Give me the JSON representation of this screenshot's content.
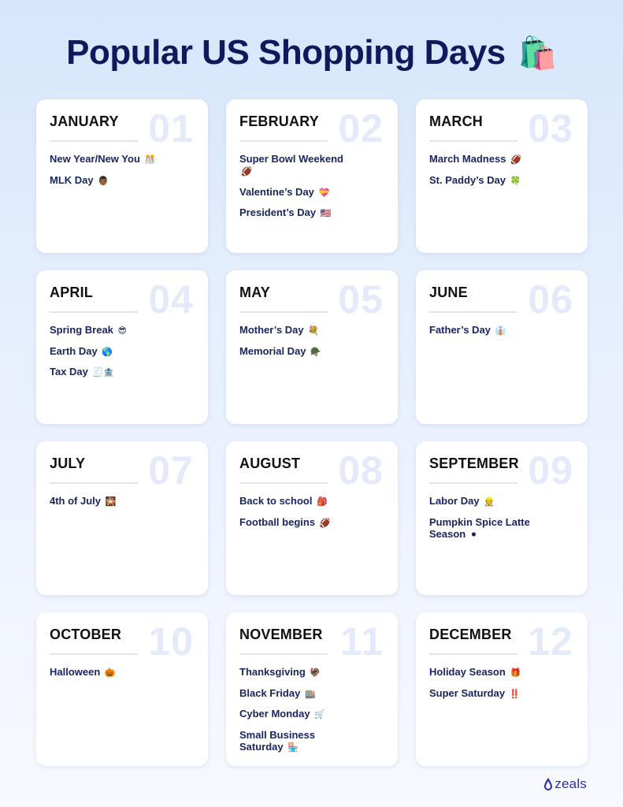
{
  "title": {
    "text": "Popular US Shopping Days",
    "emoji": "🛍️"
  },
  "months": [
    {
      "name": "JANUARY",
      "number": "01",
      "events": [
        {
          "label": "New Year/New You",
          "emoji": "🎊",
          "icon": "party-icon"
        },
        {
          "label": "MLK Day",
          "emoji": "👨🏾",
          "icon": "person-icon"
        }
      ]
    },
    {
      "name": "FEBRUARY",
      "number": "02",
      "events": [
        {
          "label": "Super Bowl Weekend",
          "emoji": "🏈",
          "icon": "football-icon"
        },
        {
          "label": "Valentine’s Day",
          "emoji": "💝",
          "icon": "heart-icon"
        },
        {
          "label": "President’s Day",
          "emoji": "🇺🇸",
          "icon": "us-flag-icon"
        }
      ]
    },
    {
      "name": "MARCH",
      "number": "03",
      "events": [
        {
          "label": "March Madness",
          "emoji": "🏈",
          "icon": "ball-icon"
        },
        {
          "label": "St. Paddy’s Day",
          "emoji": "🍀",
          "icon": "clover-icon"
        }
      ]
    },
    {
      "name": "APRIL",
      "number": "04",
      "events": [
        {
          "label": "Spring Break",
          "emoji": "😎",
          "icon": "sunglasses-face-icon"
        },
        {
          "label": "Earth Day",
          "emoji": "🌎",
          "icon": "globe-icon"
        },
        {
          "label": "Tax Day",
          "emoji": "🧾🏦",
          "icon": "receipt-bank-icon"
        }
      ]
    },
    {
      "name": "MAY",
      "number": "05",
      "events": [
        {
          "label": "Mother’s Day",
          "emoji": "💐",
          "icon": "bouquet-icon"
        },
        {
          "label": "Memorial Day",
          "emoji": "🪖",
          "icon": "helmet-icon"
        }
      ]
    },
    {
      "name": "JUNE",
      "number": "06",
      "events": [
        {
          "label": "Father’s Day",
          "emoji": "👔",
          "icon": "necktie-icon"
        }
      ]
    },
    {
      "name": "JULY",
      "number": "07",
      "events": [
        {
          "label": "4th of July",
          "emoji": "🎇",
          "icon": "fireworks-icon"
        }
      ]
    },
    {
      "name": "AUGUST",
      "number": "08",
      "events": [
        {
          "label": "Back to school",
          "emoji": "🎒",
          "icon": "backpack-icon"
        },
        {
          "label": "Football begins",
          "emoji": "🏈",
          "icon": "football-icon"
        }
      ]
    },
    {
      "name": "SEPTEMBER",
      "number": "09",
      "events": [
        {
          "label": "Labor Day",
          "emoji": "👷",
          "icon": "worker-icon"
        },
        {
          "label": "Pumpkin Spice Latte Season",
          "emoji": "⚫",
          "icon": "black-circle-icon"
        }
      ]
    },
    {
      "name": "OCTOBER",
      "number": "10",
      "events": [
        {
          "label": "Halloween",
          "emoji": "🎃",
          "icon": "pumpkin-icon"
        }
      ]
    },
    {
      "name": "NOVEMBER",
      "number": "11",
      "events": [
        {
          "label": "Thanksgiving",
          "emoji": "🦃",
          "icon": "turkey-icon"
        },
        {
          "label": "Black Friday",
          "emoji": "🏬",
          "icon": "store-icon"
        },
        {
          "label": "Cyber Monday",
          "emoji": "🛒",
          "icon": "cart-icon"
        },
        {
          "label": "Small Business Saturday",
          "emoji": "🏪",
          "icon": "shop-icon"
        }
      ]
    },
    {
      "name": "DECEMBER",
      "number": "12",
      "events": [
        {
          "label": "Holiday Season",
          "emoji": "🎁",
          "icon": "gift-icon"
        },
        {
          "label": "Super Saturday",
          "emoji": "‼️",
          "icon": "double-exclamation-icon"
        }
      ]
    }
  ],
  "brand": {
    "name": "zeals",
    "color": "#2a2fa8"
  },
  "colors": {
    "title": "#0f1a5c",
    "event_text": "#1b2560",
    "month_text": "#111111",
    "number_watermark": "#e4eaf9"
  }
}
